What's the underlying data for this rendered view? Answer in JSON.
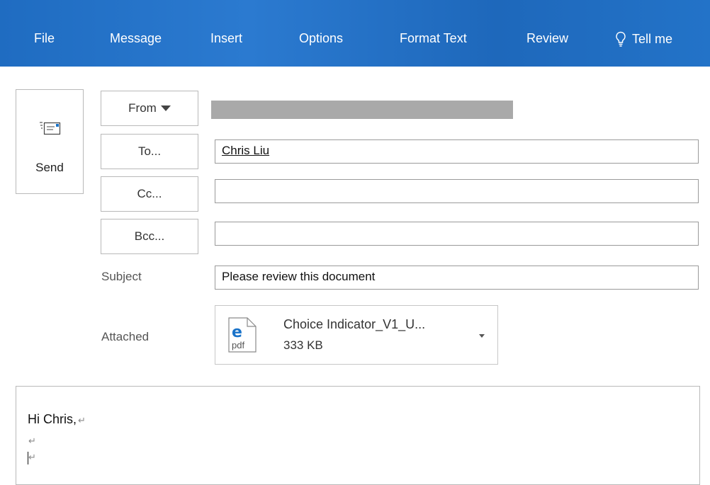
{
  "ribbon": {
    "tabs": [
      "File",
      "Message",
      "Insert",
      "Options",
      "Format Text",
      "Review"
    ],
    "tell_me": "Tell me"
  },
  "compose": {
    "send_label": "Send",
    "from_label": "From",
    "to_label": "To...",
    "cc_label": "Cc...",
    "bcc_label": "Bcc...",
    "to_value": "Chris Liu",
    "cc_value": "",
    "bcc_value": "",
    "subject_label": "Subject",
    "subject_value": "Please review this document",
    "attached_label": "Attached"
  },
  "attachment": {
    "name": "Choice Indicator_V1_U...",
    "size": "333 KB",
    "icon_text": "pdf"
  },
  "body": {
    "greeting": "Hi Chris,",
    "para_mark": "↵"
  },
  "colors": {
    "ribbon": "#1e6bbf",
    "redaction": "#a9a9a9",
    "pdf_icon": "#1a73c9"
  }
}
